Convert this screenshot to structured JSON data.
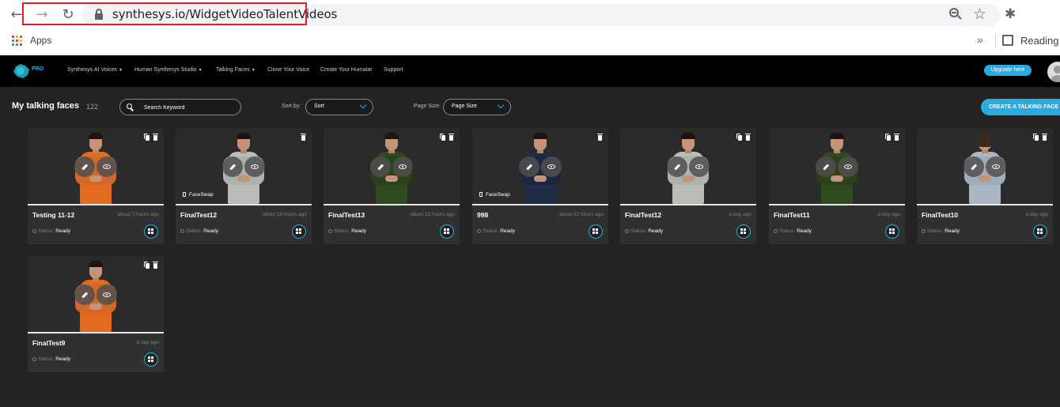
{
  "browser": {
    "url": "synthesys.io/WidgetVideoTalentVideos",
    "bookmarks": {
      "apps_label": "Apps",
      "reading_label": "Reading l"
    }
  },
  "app": {
    "logo_badge": "PRO",
    "nav": [
      {
        "label": "Synthesys AI Voices",
        "caret": "▾"
      },
      {
        "label": "Human Synthesys Studio",
        "caret": "▾"
      },
      {
        "label": "Talking Faces",
        "caret": "▾"
      },
      {
        "label": "Clone Your Voice",
        "caret": ""
      },
      {
        "label": "Create Your Humatar",
        "caret": ""
      },
      {
        "label": "Support",
        "caret": ""
      }
    ],
    "upgrade_label": "Upgrade here",
    "accent_color": "#29abe2"
  },
  "content": {
    "title": "My talking faces",
    "count": "122",
    "search_placeholder": "Search Keyword",
    "sort_label": "Sort by:",
    "sort_value": "Sort",
    "page_size_label": "Page Size:",
    "page_size_value": "Page Size",
    "create_label": "CREATE A TALKING FACE"
  },
  "cards": [
    {
      "title": "Testing 11-12",
      "time": "about 7 hours ago",
      "status_label": "Status:",
      "status": "Ready",
      "faceswap": "",
      "outfit": "vest",
      "show_copy": true
    },
    {
      "title": "FinalTest12",
      "time": "about 16 hours ago",
      "status_label": "Status:",
      "status": "Ready",
      "faceswap": "FaceSwap",
      "outfit": "grey",
      "show_copy": false
    },
    {
      "title": "FinalTest13",
      "time": "about 21 hours ago",
      "status_label": "Status:",
      "status": "Ready",
      "faceswap": "",
      "outfit": "green",
      "show_copy": true
    },
    {
      "title": "998",
      "time": "about 22 hours ago",
      "status_label": "Status:",
      "status": "Ready",
      "faceswap": "FaceSwap",
      "outfit": "suit",
      "show_copy": false
    },
    {
      "title": "FinalTest12",
      "time": "a day ago",
      "status_label": "Status:",
      "status": "Ready",
      "faceswap": "",
      "outfit": "grey",
      "show_copy": true
    },
    {
      "title": "FinalTest11",
      "time": "a day ago",
      "status_label": "Status:",
      "status": "Ready",
      "faceswap": "",
      "outfit": "green",
      "show_copy": true
    },
    {
      "title": "FinalTest10",
      "time": "a day ago",
      "status_label": "Status:",
      "status": "Ready",
      "faceswap": "",
      "outfit": "woman",
      "show_copy": true
    },
    {
      "title": "FinalTest9",
      "time": "a day ago",
      "status_label": "Status:",
      "status": "Ready",
      "faceswap": "",
      "outfit": "vest",
      "show_copy": true
    }
  ]
}
